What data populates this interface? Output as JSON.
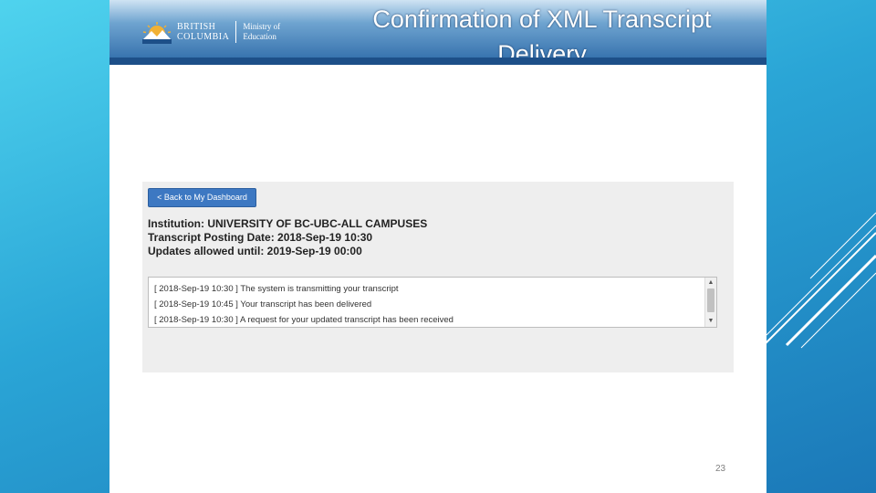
{
  "slide": {
    "title_line1": "Confirmation of XML Transcript",
    "title_line2": "Delivery",
    "page_number": "23"
  },
  "logo": {
    "line1": "BRITISH",
    "line2": "COLUMBIA",
    "ministry_line1": "Ministry of",
    "ministry_line2": "Education"
  },
  "panel": {
    "back_button": "< Back to My Dashboard",
    "institution": "Institution: UNIVERSITY OF BC-UBC-ALL CAMPUSES",
    "posting_date": "Transcript Posting Date: 2018-Sep-19 10:30",
    "updates_until": "Updates allowed until: 2019-Sep-19 00:00",
    "log": [
      "[ 2018-Sep-19 10:30 ] The system is transmitting your transcript",
      "[ 2018-Sep-19 10:45 ] Your transcript has been delivered",
      "[ 2018-Sep-19 10:30 ] A request for your updated transcript has been received"
    ]
  },
  "icons": {
    "logo_mark": "sun-mountains-logo-icon",
    "scroll_up": "chevron-up-icon",
    "scroll_down": "chevron-down-icon"
  },
  "colors": {
    "button_blue": "#3d78c2",
    "banner_blue": "#2d6aa8",
    "background_cyan": "#4fd3ee",
    "background_blue": "#1b78b8"
  }
}
